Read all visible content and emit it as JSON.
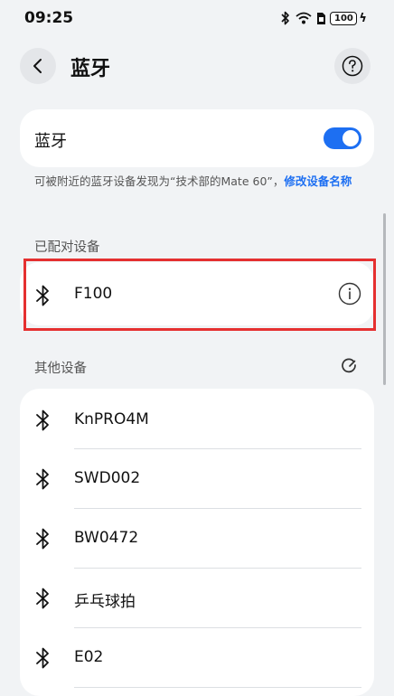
{
  "status_bar": {
    "time": "09:25",
    "battery": "100",
    "icons": [
      "bluetooth-icon",
      "wifi-icon",
      "sim-icon",
      "battery-icon",
      "charging-icon"
    ]
  },
  "header": {
    "title": "蓝牙",
    "back_icon": "back-arrow-icon",
    "help_icon": "question-icon"
  },
  "bluetooth_toggle": {
    "label": "蓝牙",
    "enabled": true
  },
  "visibility_note": {
    "text": "可被附近的蓝牙设备发现为“技术部的Mate 60”，",
    "link": "修改设备名称"
  },
  "paired": {
    "section_label": "已配对设备",
    "devices": [
      {
        "name": "F100"
      }
    ]
  },
  "other": {
    "section_label": "其他设备",
    "devices": [
      {
        "name": "KnPRO4M"
      },
      {
        "name": "SWD002"
      },
      {
        "name": "BW0472"
      },
      {
        "name": "乒乓球拍"
      },
      {
        "name": "E02"
      }
    ]
  },
  "colors": {
    "accent": "#1d6ff2",
    "highlight": "#e53030",
    "background": "#f1f3f5"
  }
}
